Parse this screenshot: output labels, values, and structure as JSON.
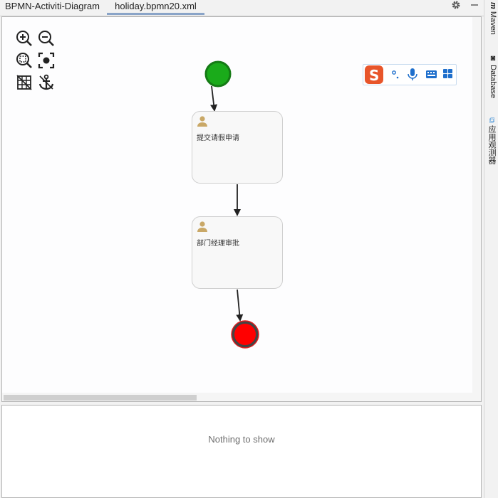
{
  "tabs": {
    "diagram_label": "BPMN-Activiti-Diagram",
    "file_label": "holiday.bpmn20.xml"
  },
  "right_strip": {
    "maven_label": "Maven",
    "database_label": "Database",
    "observer_label": "应用观测器"
  },
  "diagram": {
    "start_event_color": "#1aab1a",
    "end_event_color": "#ff0000",
    "tasks": [
      {
        "label": "提交请假申请"
      },
      {
        "label": "部门经理审批"
      }
    ]
  },
  "toolbar": {
    "icons": [
      "zoom-in-icon",
      "zoom-out-icon",
      "zoom-fit-icon",
      "zoom-actual-icon",
      "grid-icon",
      "anchor-icon"
    ]
  },
  "bottom_panel": {
    "empty_text": "Nothing to show"
  }
}
